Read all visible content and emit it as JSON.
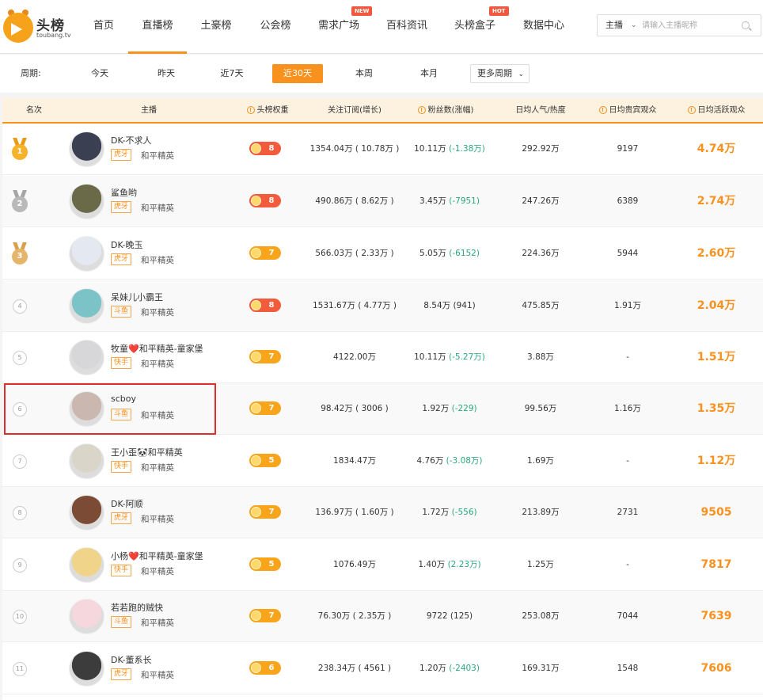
{
  "brand": {
    "name": "头榜",
    "sub": "toubang.tv"
  },
  "nav": [
    {
      "label": "首页"
    },
    {
      "label": "直播榜",
      "active": true
    },
    {
      "label": "土豪榜"
    },
    {
      "label": "公会榜"
    },
    {
      "label": "需求广场",
      "badge": "NEW"
    },
    {
      "label": "百科资讯"
    },
    {
      "label": "头榜盒子",
      "badge": "HOT"
    },
    {
      "label": "数据中心"
    }
  ],
  "search": {
    "type": "主播",
    "placeholder": "请输入主播昵称"
  },
  "period": {
    "label": "周期:",
    "items": [
      "今天",
      "昨天",
      "近7天",
      "近30天",
      "本周",
      "本月"
    ],
    "active": "近30天",
    "more": "更多周期"
  },
  "table": {
    "headers": [
      "名次",
      "主播",
      "头榜权重",
      "关注订阅(增长)",
      "粉丝数(涨幅)",
      "日均人气/热度",
      "日均贵宾观众",
      "日均活跃观众"
    ],
    "rows": [
      {
        "rank": "1",
        "name": "DK-不求人",
        "platform": "虎牙",
        "game": "和平精英",
        "weight": "8",
        "weight_color": "red",
        "follow": "1354.04万 ( 10.78万 )",
        "fans": "10.11万",
        "fans_change": "(-1.38万)",
        "popularity": "292.92万",
        "vip": "9197",
        "active": "4.74万"
      },
      {
        "rank": "2",
        "name": "鲨鱼哟",
        "platform": "虎牙",
        "game": "和平精英",
        "weight": "8",
        "weight_color": "red",
        "follow": "490.86万 ( 8.62万 )",
        "fans": "3.45万",
        "fans_change": "(-7951)",
        "popularity": "247.26万",
        "vip": "6389",
        "active": "2.74万"
      },
      {
        "rank": "3",
        "name": "DK-晚玉",
        "platform": "虎牙",
        "game": "和平精英",
        "weight": "7",
        "weight_color": "orange",
        "follow": "566.03万 ( 2.33万 )",
        "fans": "5.05万",
        "fans_change": "(-6152)",
        "popularity": "224.36万",
        "vip": "5944",
        "active": "2.60万"
      },
      {
        "rank": "4",
        "name": "呆妹儿小霸王",
        "platform": "斗鱼",
        "game": "和平精英",
        "weight": "8",
        "weight_color": "red",
        "follow": "1531.67万 ( 4.77万 )",
        "fans": "8.54万",
        "fans_change": "(941)",
        "popularity": "475.85万",
        "vip": "1.91万",
        "active": "2.04万"
      },
      {
        "rank": "5",
        "name": "牧童❤️和平精英-童家堡",
        "platform": "快手",
        "game": "和平精英",
        "weight": "7",
        "weight_color": "orange",
        "follow": "4122.00万",
        "fans": "10.11万",
        "fans_change": "(-5.27万)",
        "popularity": "3.88万",
        "vip": "-",
        "active": "1.51万"
      },
      {
        "rank": "6",
        "name": "scboy",
        "platform": "斗鱼",
        "game": "和平精英",
        "weight": "7",
        "weight_color": "orange",
        "follow": "98.42万 ( 3006 )",
        "fans": "1.92万",
        "fans_change": "(-229)",
        "popularity": "99.56万",
        "vip": "1.16万",
        "active": "1.35万"
      },
      {
        "rank": "7",
        "name": "王小歪🐼和平精英",
        "platform": "快手",
        "game": "和平精英",
        "weight": "5",
        "weight_color": "orange",
        "follow": "1834.47万",
        "fans": "4.76万",
        "fans_change": "(-3.08万)",
        "popularity": "1.69万",
        "vip": "-",
        "active": "1.12万"
      },
      {
        "rank": "8",
        "name": "DK-阿顺",
        "platform": "虎牙",
        "game": "和平精英",
        "weight": "7",
        "weight_color": "orange",
        "follow": "136.97万 ( 1.60万 )",
        "fans": "1.72万",
        "fans_change": "(-556)",
        "popularity": "213.89万",
        "vip": "2731",
        "active": "9505"
      },
      {
        "rank": "9",
        "name": "小杨❤️和平精英-童家堡",
        "platform": "快手",
        "game": "和平精英",
        "weight": "5",
        "weight_color": "orange",
        "follow": "1076.49万",
        "fans": "1.40万",
        "fans_change": "(2.23万)",
        "popularity": "1.25万",
        "vip": "-",
        "active": "7817"
      },
      {
        "rank": "10",
        "name": "若若跑的贼快",
        "platform": "斗鱼",
        "game": "和平精英",
        "weight": "7",
        "weight_color": "orange",
        "follow": "76.30万 ( 2.35万 )",
        "fans": "9722",
        "fans_change": "(125)",
        "popularity": "253.08万",
        "vip": "7044",
        "active": "7639"
      },
      {
        "rank": "11",
        "name": "DK-董系长",
        "platform": "虎牙",
        "game": "和平精英",
        "weight": "6",
        "weight_color": "orange",
        "follow": "238.34万 ( 4561 )",
        "fans": "1.20万",
        "fans_change": "(-2403)",
        "popularity": "169.31万",
        "vip": "1548",
        "active": "7606"
      }
    ]
  },
  "colors": {
    "accent": "#f8911e",
    "header_bg": "#fdf1e0",
    "green": "#2aa87a",
    "highlight": "#e02e2e"
  }
}
